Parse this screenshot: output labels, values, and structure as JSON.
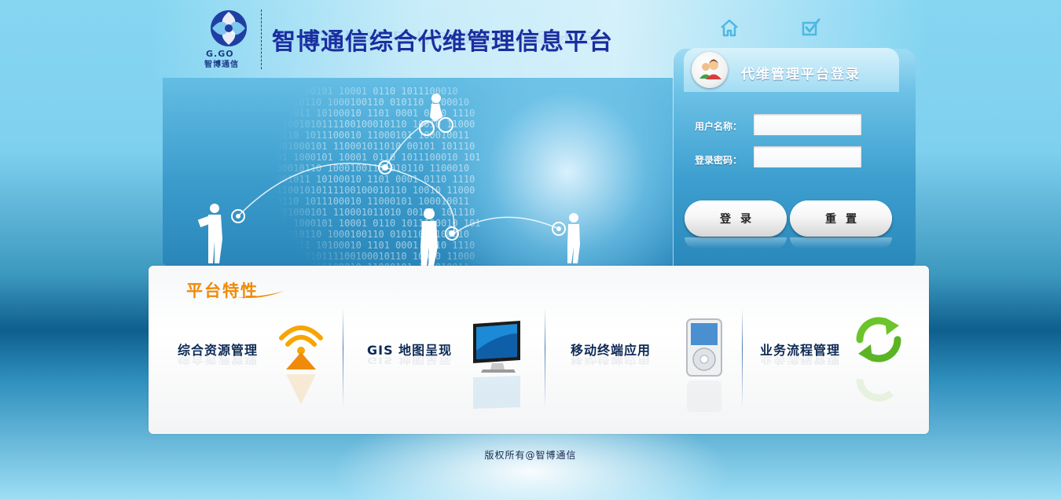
{
  "header": {
    "logo_letters": "G.GO",
    "logo_cn": "智博通信",
    "title": "智博通信综合代维管理信息平台",
    "icons": [
      "home-icon",
      "checkbox-icon"
    ]
  },
  "login": {
    "title": "代维管理平台登录",
    "username_label": "用户名称：",
    "password_label": "登录密码：",
    "username_value": "",
    "password_value": "",
    "login_button": "登录",
    "reset_button": "重置"
  },
  "features": {
    "title": "平台特性",
    "items": [
      {
        "label": "综合资源管理",
        "icon": "wifi-cone-icon"
      },
      {
        "label": "GIS 地图呈现",
        "icon": "monitor-icon"
      },
      {
        "label": "移动终端应用",
        "icon": "media-player-icon"
      },
      {
        "label": "业务流程管理",
        "icon": "refresh-arrows-icon"
      }
    ]
  },
  "footer": {
    "copyright": "版权所有@智博通信"
  },
  "colors": {
    "title_blue": "#1a2ea0",
    "feature_orange": "#f08a0a",
    "feature_text": "#0d2a55"
  }
}
